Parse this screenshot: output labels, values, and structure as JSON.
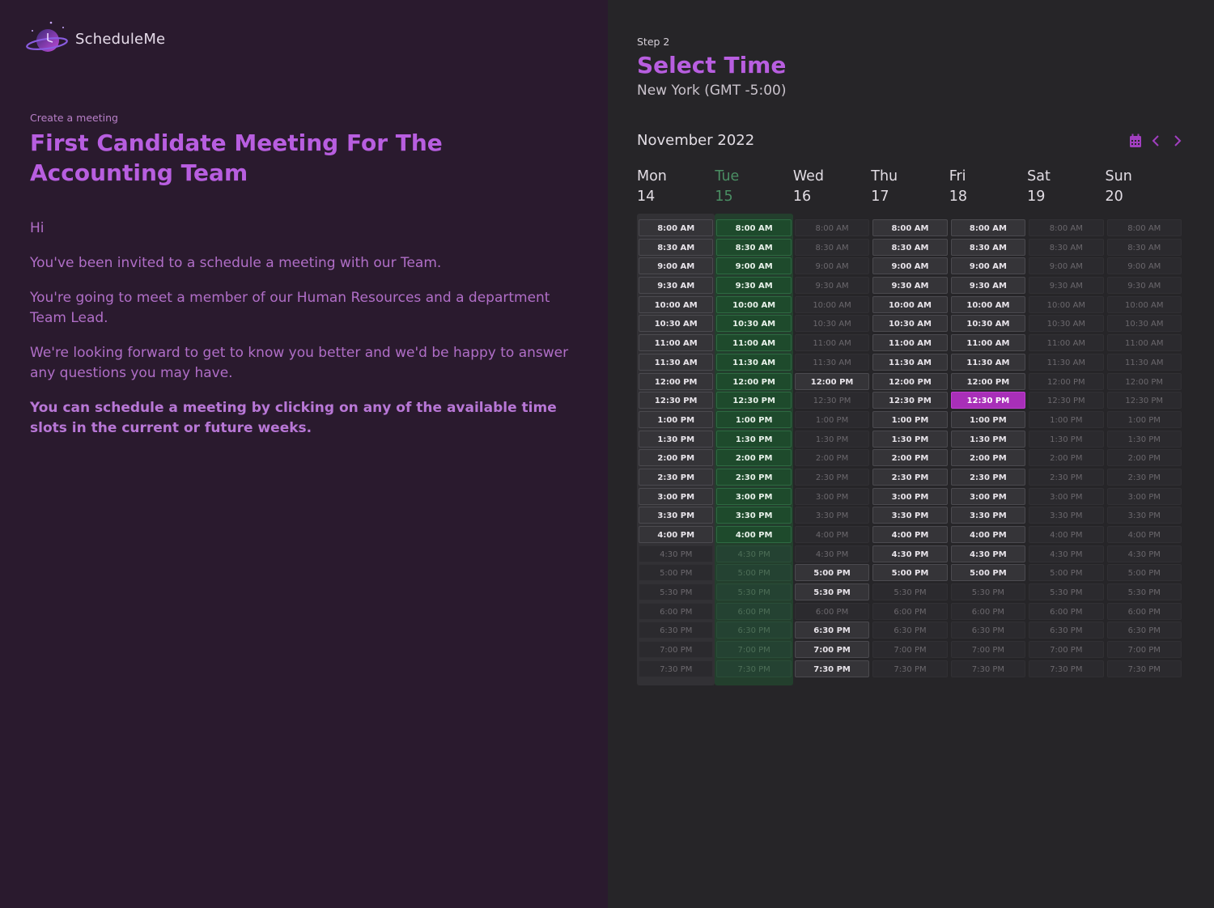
{
  "app": {
    "name": "ScheduleMe",
    "logo": "planet-clock-logo"
  },
  "left": {
    "breadcrumb": "Create a meeting",
    "title": "First Candidate Meeting For The Accounting Team",
    "greeting": "Hi",
    "p1": "You've been invited to a schedule a meeting with our Team.",
    "p2": "You're going to meet a member of our Human Resources and a department Team Lead.",
    "p3": "We're looking forward to get to know you better and we'd be happy to answer any questions you may have.",
    "p4": "You can schedule a meeting by clicking on any of the available time slots in the current or future weeks."
  },
  "right": {
    "step": "Step 2",
    "title": "Select Time",
    "timezone": "New York (GMT -5:00)",
    "month": "November 2022",
    "icons": {
      "calendar": "calendar-icon",
      "prev": "chevron-left-icon",
      "next": "chevron-right-icon"
    },
    "accent": "#b85ee0"
  },
  "days": [
    {
      "name": "Mon",
      "date": "14"
    },
    {
      "name": "Tue",
      "date": "15",
      "today": true
    },
    {
      "name": "Wed",
      "date": "16"
    },
    {
      "name": "Thu",
      "date": "17"
    },
    {
      "name": "Fri",
      "date": "18"
    },
    {
      "name": "Sat",
      "date": "19"
    },
    {
      "name": "Sun",
      "date": "20"
    }
  ],
  "times": [
    "8:00 AM",
    "8:30 AM",
    "9:00 AM",
    "9:30 AM",
    "10:00 AM",
    "10:30 AM",
    "11:00 AM",
    "11:30 AM",
    "12:00 PM",
    "12:30 PM",
    "1:00 PM",
    "1:30 PM",
    "2:00 PM",
    "2:30 PM",
    "3:00 PM",
    "3:30 PM",
    "4:00 PM",
    "4:30 PM",
    "5:00 PM",
    "5:30 PM",
    "6:00 PM",
    "6:30 PM",
    "7:00 PM",
    "7:30 PM"
  ],
  "availability": [
    "111111111111111110000000",
    "111111111111111110000000",
    "000000001000000000110111",
    "111111111111111111100000",
    "111111111111111111100000",
    "000000000000000000000000",
    "000000000000000000000000"
  ],
  "selected": {
    "day": 4,
    "time": 9
  }
}
